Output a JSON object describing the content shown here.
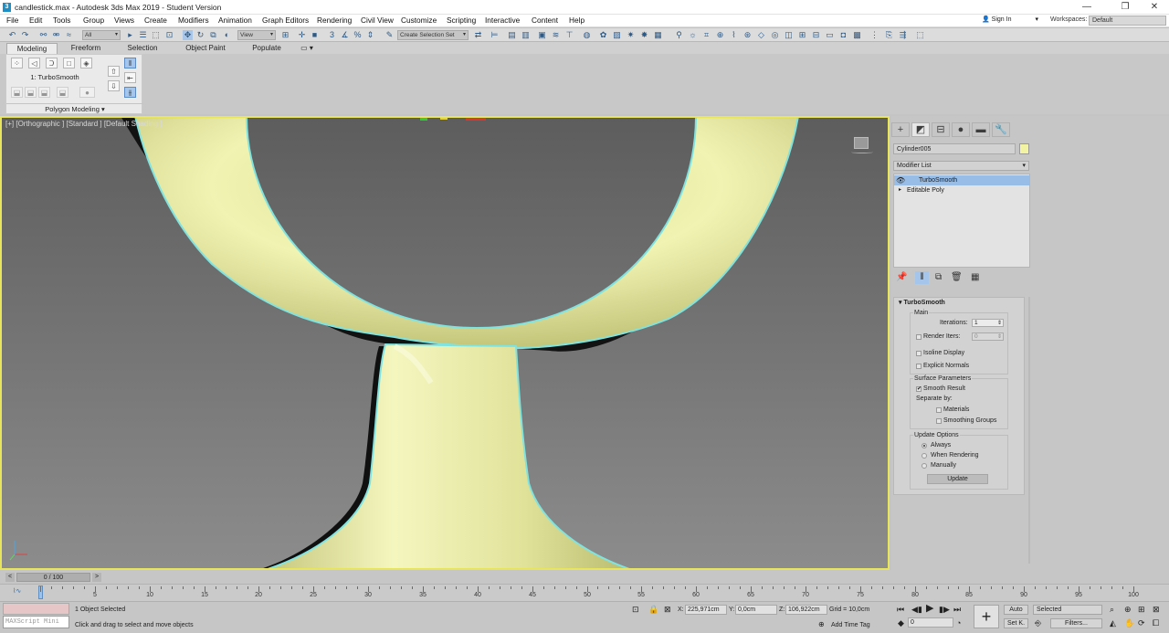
{
  "window": {
    "title": "candlestick.max - Autodesk 3ds Max 2019 - Student Version",
    "app_icon": "3",
    "minimize": "—",
    "maximize": "❐",
    "close": "✕"
  },
  "menu": [
    "File",
    "Edit",
    "Tools",
    "Group",
    "Views",
    "Create",
    "Modifiers",
    "Animation",
    "Graph Editors",
    "Rendering",
    "Civil View",
    "Customize",
    "Scripting",
    "Interactive",
    "Content",
    "Help"
  ],
  "account": {
    "sign_in": "Sign In",
    "workspaces_label": "Workspaces:",
    "workspace_value": "Default"
  },
  "toolbar": {
    "selection_filter": "All",
    "reference_coord": "View",
    "selection_set": "Create Selection Set"
  },
  "ribbon": {
    "tabs": [
      "Modeling",
      "Freeform",
      "Selection",
      "Object Paint",
      "Populate"
    ],
    "active_tab": "Modeling",
    "modifier_label": "1: TurboSmooth",
    "panel_label": "Polygon Modeling ▾"
  },
  "viewport": {
    "label": "[+] [Orthographic ] [Standard ] [Default Shading ]",
    "object_color": "#eef0a8",
    "outline_color": "#7fe3e0",
    "border_color": "#e9e55b"
  },
  "command_panel": {
    "object_name": "Cylinder005",
    "modifier_list": "Modifier List",
    "stack": [
      {
        "label": "TurboSmooth",
        "selected": true,
        "prefix": "👁"
      },
      {
        "label": "Editable Poly",
        "selected": false,
        "prefix": "▸"
      }
    ],
    "rollout": {
      "title": "TurboSmooth",
      "main_label": "Main",
      "iterations_label": "Iterations:",
      "iterations_value": "1",
      "render_iters_label": "Render Iters:",
      "render_iters_value": "0",
      "isoline_label": "Isoline Display",
      "explicit_normals_label": "Explicit Normals",
      "surface_params_label": "Surface Parameters",
      "smooth_result_label": "Smooth Result",
      "smooth_result_checked": true,
      "separate_by_label": "Separate by:",
      "materials_label": "Materials",
      "smoothing_groups_label": "Smoothing Groups",
      "update_options_label": "Update Options",
      "always_label": "Always",
      "when_rendering_label": "When Rendering",
      "manually_label": "Manually",
      "update_button": "Update"
    }
  },
  "timeline": {
    "frame_display": "0 / 100",
    "left_arrow": "<",
    "right_arrow": ">",
    "ticks": [
      5,
      10,
      15,
      20,
      25,
      30,
      35,
      40,
      45,
      50,
      55,
      60,
      65,
      70,
      75,
      80,
      85,
      90,
      95,
      100
    ]
  },
  "status": {
    "maxscript_placeholder": "MAXScript Mini",
    "selected": "1 Object Selected",
    "prompt": "Click and drag to select and move objects",
    "x_label": "X:",
    "x_value": "225,971cm",
    "y_label": "Y:",
    "y_value": "0,0cm",
    "z_label": "Z:",
    "z_value": "106,922cm",
    "grid": "Grid = 10,0cm",
    "add_time_tag": "Add Time Tag",
    "auto_key": "Auto",
    "set_key": "Set K.",
    "key_filter_value": "Selected",
    "filters": "Filters...",
    "current_frame": "0"
  }
}
